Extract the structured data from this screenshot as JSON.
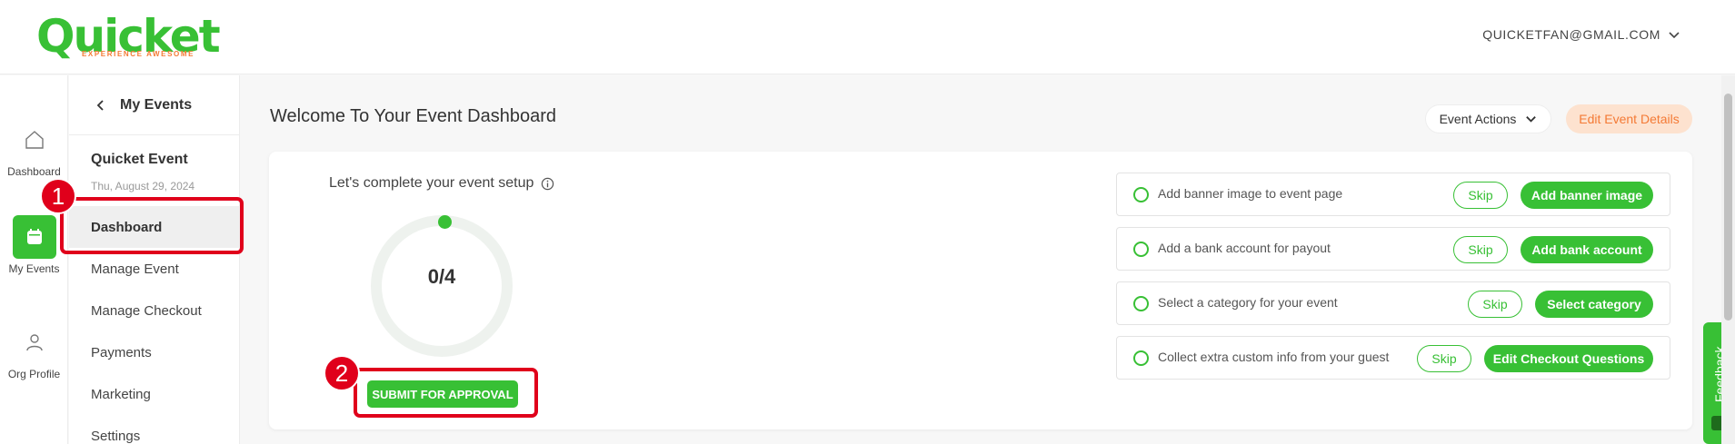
{
  "brand": {
    "name": "Quicket",
    "tagline": "EXPERIENCE AWESOME",
    "primary_color": "#38c035",
    "accent_color": "#f47a35"
  },
  "header": {
    "account_email": "QUICKETFAN@GMAIL.COM"
  },
  "rail": {
    "items": [
      {
        "label": "Dashboard",
        "icon": "home-icon",
        "active": false
      },
      {
        "label": "My Events",
        "icon": "calendar-icon",
        "active": true
      },
      {
        "label": "Org Profile",
        "icon": "user-icon",
        "active": false
      }
    ]
  },
  "sidebar": {
    "back_label": "My Events",
    "event_name": "Quicket Event",
    "event_date": "Thu, August 29, 2024",
    "items": [
      {
        "label": "Dashboard",
        "active": true
      },
      {
        "label": "Manage Event",
        "active": false
      },
      {
        "label": "Manage Checkout",
        "active": false
      },
      {
        "label": "Payments",
        "active": false
      },
      {
        "label": "Marketing",
        "active": false
      },
      {
        "label": "Settings",
        "active": false
      }
    ]
  },
  "main": {
    "title": "Welcome To Your Event Dashboard",
    "event_actions_label": "Event Actions",
    "edit_details_label": "Edit Event Details",
    "setup": {
      "heading": "Let's complete your event setup",
      "progress_text": "0/4",
      "completed": 0,
      "total": 4,
      "submit_label": "SUBMIT FOR APPROVAL"
    },
    "tasks": [
      {
        "text": "Add banner image to event page",
        "skip_label": "Skip",
        "action_label": "Add banner image"
      },
      {
        "text": "Add a bank account for payout",
        "skip_label": "Skip",
        "action_label": "Add bank account"
      },
      {
        "text": "Select a category for your event",
        "skip_label": "Skip",
        "action_label": "Select category"
      },
      {
        "text": "Collect extra custom info from your guest",
        "skip_label": "Skip",
        "action_label": "Edit Checkout Questions"
      }
    ]
  },
  "annotations": [
    {
      "number": "1",
      "target": "Dashboard"
    },
    {
      "number": "2",
      "target": "SUBMIT FOR APPROVAL"
    }
  ],
  "feedback_label": "Feedback",
  "highlight_color": "#e0001b"
}
